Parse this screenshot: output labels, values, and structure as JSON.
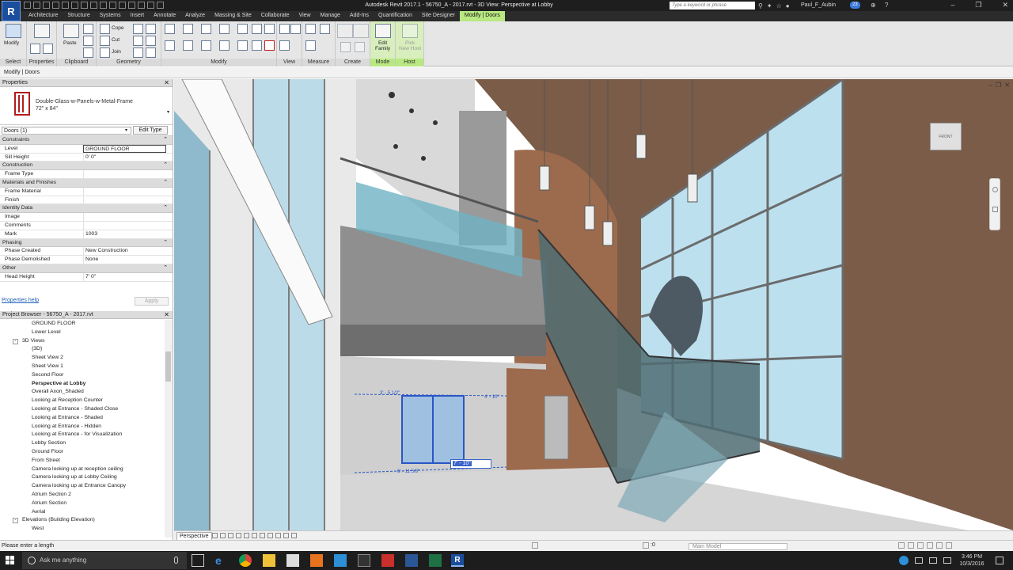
{
  "titlebar": {
    "app_title": "Autodesk Revit 2017.1 -    56750_A - 2017.rvt - 3D View: Perspective at Lobby",
    "search_placeholder": "Type a keyword or phrase",
    "user": "Paul_F_Aubin",
    "notifications": "23",
    "logo": "R"
  },
  "ribbon": {
    "tabs": [
      "Architecture",
      "Structure",
      "Systems",
      "Insert",
      "Annotate",
      "Analyze",
      "Massing & Site",
      "Collaborate",
      "View",
      "Manage",
      "Add-Ins",
      "Quantification",
      "Site Designer",
      "Modify | Doors"
    ],
    "active_tab": "Modify | Doors",
    "panels": {
      "select": "Select",
      "properties": "Properties",
      "clipboard": "Clipboard",
      "geometry": "Geometry",
      "modify": "Modify",
      "view": "View",
      "measure": "Measure",
      "create": "Create",
      "mode": "Mode",
      "host": "Host"
    },
    "buttons": {
      "modify": "Modify",
      "paste": "Paste",
      "cope": "Cope",
      "cut": "Cut",
      "join": "Join",
      "edit_family": "Edit\nFamily",
      "pick_new_host": "Pick\nNew Host"
    }
  },
  "context_bar": "Modify | Doors",
  "properties": {
    "title": "Properties",
    "type_name": "Double-Glass-w-Panels-w-Metal-Frame",
    "type_size": "72\" x 84\"",
    "instance_filter": "Doors (1)",
    "edit_type": "Edit Type",
    "groups": [
      {
        "name": "Constraints",
        "rows": [
          {
            "k": "Level",
            "v": "GROUND FLOOR"
          },
          {
            "k": "Sill Height",
            "v": "0'  0\""
          }
        ]
      },
      {
        "name": "Construction",
        "rows": [
          {
            "k": "Frame Type",
            "v": ""
          }
        ]
      },
      {
        "name": "Materials and Finishes",
        "rows": [
          {
            "k": "Frame Material",
            "v": ""
          },
          {
            "k": "Finish",
            "v": ""
          }
        ]
      },
      {
        "name": "Identity Data",
        "rows": [
          {
            "k": "Image",
            "v": ""
          },
          {
            "k": "Comments",
            "v": ""
          },
          {
            "k": "Mark",
            "v": "1003"
          }
        ]
      },
      {
        "name": "Phasing",
        "rows": [
          {
            "k": "Phase Created",
            "v": "New Construction"
          },
          {
            "k": "Phase Demolished",
            "v": "None"
          }
        ]
      },
      {
        "name": "Other",
        "rows": [
          {
            "k": "Head Height",
            "v": "7'  0\""
          }
        ]
      }
    ],
    "help_link": "Properties help",
    "apply": "Apply"
  },
  "project_browser": {
    "title": "Project Browser - 56750_A - 2017.rvt",
    "items": [
      {
        "label": "GROUND FLOOR",
        "indent": 40,
        "exp": ""
      },
      {
        "label": "Lower Level",
        "indent": 40,
        "exp": ""
      },
      {
        "label": "3D Views",
        "indent": 28,
        "exp": "-"
      },
      {
        "label": "{3D}",
        "indent": 40,
        "exp": ""
      },
      {
        "label": "Sheet View 2",
        "indent": 40,
        "exp": ""
      },
      {
        "label": "Sheet View 1",
        "indent": 40,
        "exp": ""
      },
      {
        "label": "Second Floor",
        "indent": 40,
        "exp": ""
      },
      {
        "label": "Perspective at Lobby",
        "indent": 40,
        "exp": "",
        "bold": true
      },
      {
        "label": "Overall Axon_Shaded",
        "indent": 40,
        "exp": ""
      },
      {
        "label": "Looking at Reception Counter",
        "indent": 40,
        "exp": ""
      },
      {
        "label": "Looking at Entrance - Shaded Close",
        "indent": 40,
        "exp": ""
      },
      {
        "label": "Looking at Entrance - Shaded",
        "indent": 40,
        "exp": ""
      },
      {
        "label": "Looking at Entrance - Hidden",
        "indent": 40,
        "exp": ""
      },
      {
        "label": "Looking at Entrance - for Visualization",
        "indent": 40,
        "exp": ""
      },
      {
        "label": "Lobby Section",
        "indent": 40,
        "exp": ""
      },
      {
        "label": "Ground Floor",
        "indent": 40,
        "exp": ""
      },
      {
        "label": "From Street",
        "indent": 40,
        "exp": ""
      },
      {
        "label": "Camera looking up at reception ceiling",
        "indent": 40,
        "exp": ""
      },
      {
        "label": "Camera looking up at Lobby Ceiling",
        "indent": 40,
        "exp": ""
      },
      {
        "label": "Camera looking up at Entrance Canopy",
        "indent": 40,
        "exp": ""
      },
      {
        "label": "Atrium Section 2",
        "indent": 40,
        "exp": ""
      },
      {
        "label": "Atrium Section",
        "indent": 40,
        "exp": ""
      },
      {
        "label": "Aerial",
        "indent": 40,
        "exp": ""
      },
      {
        "label": "Elevations (Building Elevation)",
        "indent": 28,
        "exp": "-"
      },
      {
        "label": "West",
        "indent": 40,
        "exp": ""
      }
    ]
  },
  "viewport": {
    "temp_dimension": "7' - 10\"",
    "viewcube_face": "FRONT",
    "dim_left": "3' - 5 1/2\"",
    "dim_right": "4' - 10\"",
    "dim_bottom": "6' - 11 5/8\""
  },
  "view_control": {
    "view_type": "Perspective"
  },
  "status": {
    "text": "Please enter a length",
    "workset": "Main Model",
    "filter_count": ":0"
  },
  "taskbar": {
    "search_placeholder": "Ask me anything",
    "time": "3:46 PM",
    "date": "10/3/2016"
  }
}
